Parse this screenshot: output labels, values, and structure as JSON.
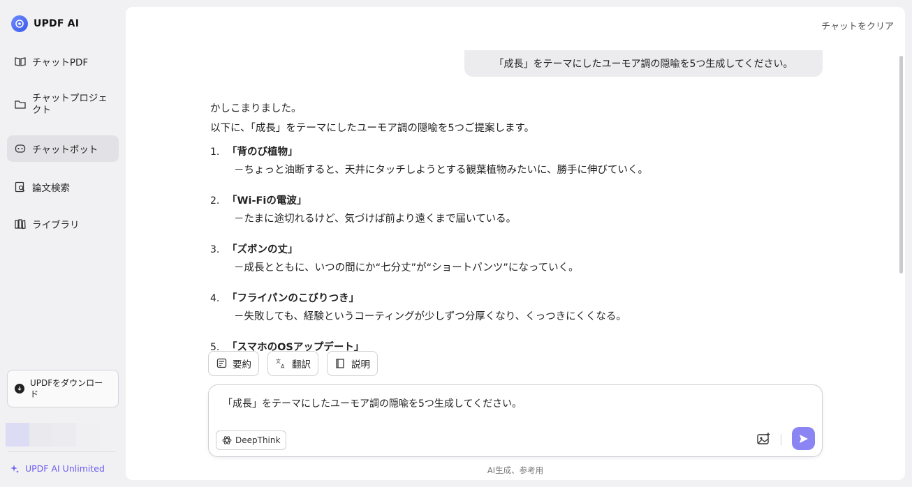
{
  "sidebar": {
    "brand": "UPDF AI",
    "items": [
      {
        "label": "チャットPDF",
        "icon": "book-chat-icon"
      },
      {
        "label": "チャットプロジェクト",
        "icon": "folder-chat-icon"
      },
      {
        "label": "チャットボット",
        "icon": "bot-icon"
      },
      {
        "label": "論文検索",
        "icon": "doc-search-icon"
      },
      {
        "label": "ライブラリ",
        "icon": "library-icon"
      }
    ],
    "active_item": "チャットボット",
    "download_label": "UPDFをダウンロード",
    "unlimited_label": "UPDF AI Unlimited"
  },
  "header": {
    "clear_chat": "チャットをクリア"
  },
  "chat": {
    "user_message": "「成長」をテーマにしたユーモア調の隠喩を5つ生成してください。",
    "answer": {
      "intro1": "かしこまりました。",
      "intro2": "以下に、「成長」をテーマにしたユーモア調の隠喩を5つご提案します。",
      "items": [
        {
          "num": "1.",
          "title": "「背のび植物」",
          "body": "－ちょっと油断すると、天井にタッチしようとする観葉植物みたいに、勝手に伸びていく。"
        },
        {
          "num": "2.",
          "title": "「Wi-Fiの電波」",
          "body": "－たまに途切れるけど、気づけば前より遠くまで届いている。"
        },
        {
          "num": "3.",
          "title": "「ズボンの丈」",
          "body": "－成長とともに、いつの間にか“七分丈”が“ショートパンツ”になっていく。"
        },
        {
          "num": "4.",
          "title": "「フライパンのこびりつき」",
          "body": "－失敗しても、経験というコーティングが少しずつ分厚くなり、くっつきにくくなる。"
        },
        {
          "num": "5.",
          "title": "「スマホのOSアップデート」",
          "body": ""
        }
      ]
    },
    "actions": [
      {
        "label": "要約",
        "icon": "summary-icon"
      },
      {
        "label": "翻訳",
        "icon": "translate-icon"
      },
      {
        "label": "説明",
        "icon": "explain-icon"
      }
    ]
  },
  "composer": {
    "value": "「成長」をテーマにしたユーモア調の隠喩を5つ生成してください。",
    "deepthink_label": "DeepThink",
    "footnote": "AI生成、参考用"
  },
  "colors": {
    "accent": "#8b84f3",
    "unlimited": "#6b5cf0",
    "active_bg": "#e2e2e6"
  }
}
